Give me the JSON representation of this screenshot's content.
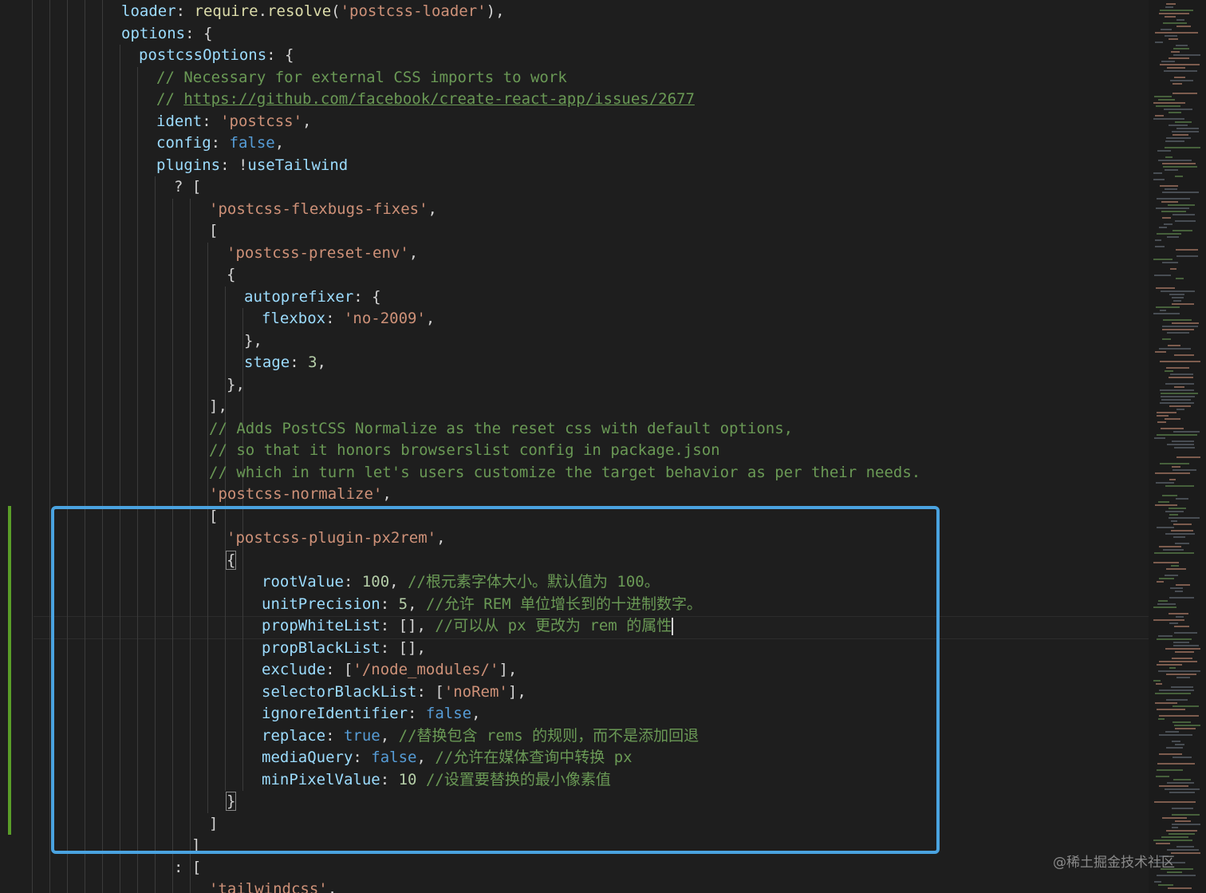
{
  "editor": {
    "lines": [
      {
        "indent": 6,
        "tokens": [
          [
            "key",
            "loader"
          ],
          [
            "pun",
            ": "
          ],
          [
            "fn",
            "require"
          ],
          [
            "pun",
            "."
          ],
          [
            "fn",
            "resolve"
          ],
          [
            "pun",
            "("
          ],
          [
            "str",
            "'postcss-loader'"
          ],
          [
            "pun",
            "),"
          ]
        ]
      },
      {
        "indent": 6,
        "tokens": [
          [
            "key",
            "options"
          ],
          [
            "pun",
            ": {"
          ]
        ]
      },
      {
        "indent": 7,
        "tokens": [
          [
            "key",
            "postcssOptions"
          ],
          [
            "pun",
            ": {"
          ]
        ]
      },
      {
        "indent": 8,
        "tokens": [
          [
            "com",
            "// Necessary for external CSS imports to work"
          ]
        ]
      },
      {
        "indent": 8,
        "tokens": [
          [
            "com",
            "// "
          ],
          [
            "link",
            "https://github.com/facebook/create-react-app/issues/2677"
          ]
        ]
      },
      {
        "indent": 8,
        "tokens": [
          [
            "key",
            "ident"
          ],
          [
            "pun",
            ": "
          ],
          [
            "str",
            "'postcss'"
          ],
          [
            "pun",
            ","
          ]
        ]
      },
      {
        "indent": 8,
        "tokens": [
          [
            "key",
            "config"
          ],
          [
            "pun",
            ": "
          ],
          [
            "kw",
            "false"
          ],
          [
            "pun",
            ","
          ]
        ]
      },
      {
        "indent": 8,
        "tokens": [
          [
            "key",
            "plugins"
          ],
          [
            "pun",
            ": !"
          ],
          [
            "key",
            "useTailwind"
          ]
        ]
      },
      {
        "indent": 9,
        "tokens": [
          [
            "pun",
            "? ["
          ]
        ]
      },
      {
        "indent": 11,
        "tokens": [
          [
            "str",
            "'postcss-flexbugs-fixes'"
          ],
          [
            "pun",
            ","
          ]
        ]
      },
      {
        "indent": 11,
        "tokens": [
          [
            "pun",
            "["
          ]
        ]
      },
      {
        "indent": 12,
        "tokens": [
          [
            "str",
            "'postcss-preset-env'"
          ],
          [
            "pun",
            ","
          ]
        ]
      },
      {
        "indent": 12,
        "tokens": [
          [
            "pun",
            "{"
          ]
        ]
      },
      {
        "indent": 13,
        "tokens": [
          [
            "key",
            "autoprefixer"
          ],
          [
            "pun",
            ": {"
          ]
        ]
      },
      {
        "indent": 14,
        "tokens": [
          [
            "key",
            "flexbox"
          ],
          [
            "pun",
            ": "
          ],
          [
            "str",
            "'no-2009'"
          ],
          [
            "pun",
            ","
          ]
        ]
      },
      {
        "indent": 13,
        "tokens": [
          [
            "pun",
            "},"
          ]
        ]
      },
      {
        "indent": 13,
        "tokens": [
          [
            "key",
            "stage"
          ],
          [
            "pun",
            ": "
          ],
          [
            "num",
            "3"
          ],
          [
            "pun",
            ","
          ]
        ]
      },
      {
        "indent": 12,
        "tokens": [
          [
            "pun",
            "},"
          ]
        ]
      },
      {
        "indent": 11,
        "tokens": [
          [
            "pun",
            "],"
          ]
        ]
      },
      {
        "indent": 11,
        "tokens": [
          [
            "com",
            "// Adds PostCSS Normalize as the reset css with default options,"
          ]
        ]
      },
      {
        "indent": 11,
        "tokens": [
          [
            "com",
            "// so that it honors browserslist config in package.json"
          ]
        ]
      },
      {
        "indent": 11,
        "tokens": [
          [
            "com",
            "// which in turn let's users customize the target behavior as per their needs."
          ]
        ]
      },
      {
        "indent": 11,
        "tokens": [
          [
            "str",
            "'postcss-normalize'"
          ],
          [
            "pun",
            ","
          ]
        ]
      },
      {
        "indent": 11,
        "tokens": [
          [
            "pun",
            "["
          ]
        ]
      },
      {
        "indent": 12,
        "tokens": [
          [
            "str",
            "'postcss-plugin-px2rem'"
          ],
          [
            "pun",
            ","
          ]
        ]
      },
      {
        "indent": 12,
        "tokens": [
          [
            "bm",
            "{"
          ]
        ]
      },
      {
        "indent": 14,
        "tokens": [
          [
            "key",
            "rootValue"
          ],
          [
            "pun",
            ": "
          ],
          [
            "num",
            "100"
          ],
          [
            "pun",
            ", "
          ],
          [
            "com",
            "//根元素字体大小。默认值为 100。"
          ]
        ]
      },
      {
        "indent": 14,
        "tokens": [
          [
            "key",
            "unitPrecision"
          ],
          [
            "pun",
            ": "
          ],
          [
            "num",
            "5"
          ],
          [
            "pun",
            ", "
          ],
          [
            "com",
            "//允许 REM 单位增长到的十进制数字。"
          ]
        ]
      },
      {
        "indent": 14,
        "tokens": [
          [
            "key",
            "propWhiteList"
          ],
          [
            "pun",
            ": [], "
          ],
          [
            "com",
            "//可以从 px 更改为 rem 的属性"
          ],
          [
            "caret",
            ""
          ]
        ]
      },
      {
        "indent": 14,
        "tokens": [
          [
            "key",
            "propBlackList"
          ],
          [
            "pun",
            ": [],"
          ]
        ]
      },
      {
        "indent": 14,
        "tokens": [
          [
            "key",
            "exclude"
          ],
          [
            "pun",
            ": ["
          ],
          [
            "str",
            "'/node_modules/'"
          ],
          [
            "pun",
            "],"
          ]
        ]
      },
      {
        "indent": 14,
        "tokens": [
          [
            "key",
            "selectorBlackList"
          ],
          [
            "pun",
            ": ["
          ],
          [
            "str",
            "'noRem'"
          ],
          [
            "pun",
            "],"
          ]
        ]
      },
      {
        "indent": 14,
        "tokens": [
          [
            "key",
            "ignoreIdentifier"
          ],
          [
            "pun",
            ": "
          ],
          [
            "kw",
            "false"
          ],
          [
            "pun",
            ","
          ]
        ]
      },
      {
        "indent": 14,
        "tokens": [
          [
            "key",
            "replace"
          ],
          [
            "pun",
            ": "
          ],
          [
            "kw",
            "true"
          ],
          [
            "pun",
            ", "
          ],
          [
            "com",
            "//替换包含 rems 的规则，而不是添加回退"
          ]
        ]
      },
      {
        "indent": 14,
        "tokens": [
          [
            "key",
            "mediaQuery"
          ],
          [
            "pun",
            ": "
          ],
          [
            "kw",
            "false"
          ],
          [
            "pun",
            ", "
          ],
          [
            "com",
            "//允许在媒体查询中转换 px"
          ]
        ]
      },
      {
        "indent": 14,
        "tokens": [
          [
            "key",
            "minPixelValue"
          ],
          [
            "pun",
            ": "
          ],
          [
            "num",
            "10"
          ],
          [
            "pun",
            " "
          ],
          [
            "com",
            "//设置要替换的最小像素值"
          ]
        ]
      },
      {
        "indent": 12,
        "tokens": [
          [
            "bm",
            "}"
          ]
        ]
      },
      {
        "indent": 11,
        "tokens": [
          [
            "pun",
            "]"
          ]
        ]
      },
      {
        "indent": 10,
        "tokens": [
          [
            "pun",
            "]"
          ]
        ]
      },
      {
        "indent": 9,
        "tokens": [
          [
            "pun",
            ": ["
          ]
        ]
      },
      {
        "indent": 11,
        "tokens": [
          [
            "str",
            "'tailwindcss'"
          ],
          [
            "pun",
            ","
          ]
        ]
      }
    ]
  },
  "watermark": "@稀土掘金技术社区",
  "colors": {
    "background": "#1e1e1e",
    "highlight_border": "#4aa3e0",
    "git_modified": "#5a9e28"
  }
}
